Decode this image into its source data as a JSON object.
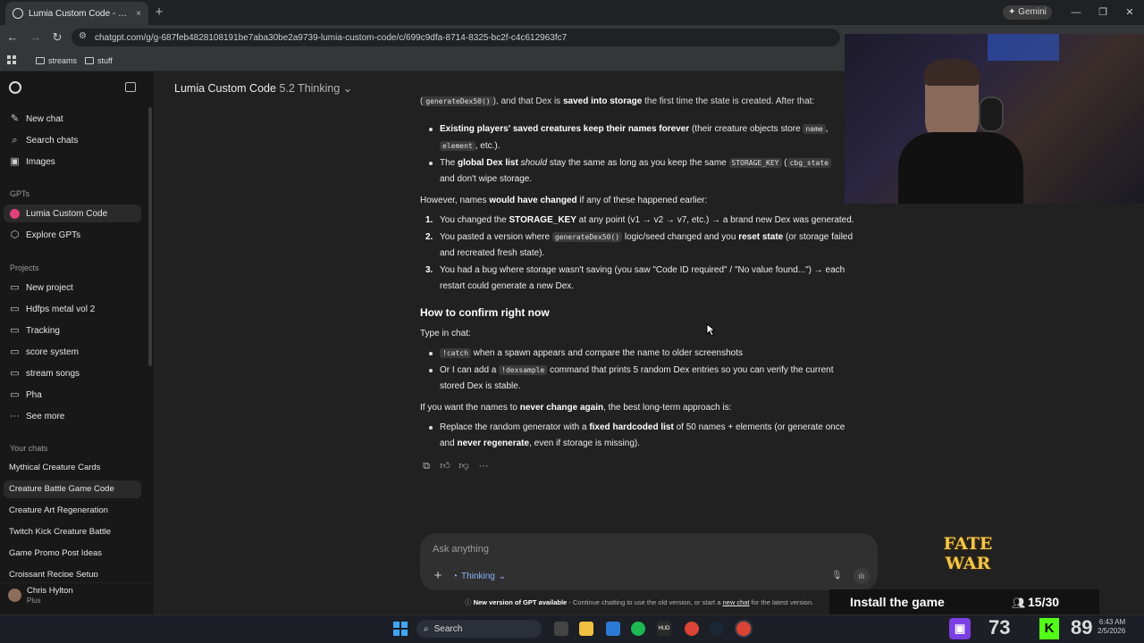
{
  "browser": {
    "tab_title": "Lumia Custom Code - Creature",
    "url": "chatgpt.com/g/g-687feb4828108191be7aba30be2a9739-lumia-custom-code/c/699c9dfa-8714-8325-bc2f-c4c612963fc7",
    "gemini_label": "Gemini",
    "bookmarks": [
      "streams",
      "stuff"
    ]
  },
  "sidebar": {
    "top_items": [
      {
        "label": "New chat",
        "icon": "edit-icon"
      },
      {
        "label": "Search chats",
        "icon": "search-icon"
      },
      {
        "label": "Images",
        "icon": "image-icon"
      }
    ],
    "gpts_heading": "GPTs",
    "gpts": [
      {
        "label": "Lumia Custom Code",
        "active": true
      },
      {
        "label": "Explore GPTs",
        "active": false
      }
    ],
    "projects_heading": "Projects",
    "projects": [
      "New project",
      "Hdfps metal vol 2",
      "Tracking",
      "score system",
      "stream songs",
      "Pha",
      "See more"
    ],
    "chats_heading": "Your chats",
    "chats": [
      "Mythical Creature Cards",
      "Creature Battle Game Code",
      "Creature Art Regeneration",
      "Twitch Kick Creature Battle",
      "Game Promo Post Ideas",
      "Croissant Recipe Setup"
    ],
    "active_chat_index": 1,
    "user": {
      "name": "Chris Hylton",
      "plan": "Plus"
    }
  },
  "header": {
    "title": "Lumia Custom Code",
    "model": "5.2 Thinking"
  },
  "message": {
    "line0_pre": "(",
    "line0_code": "generateDex50()",
    "line0_mid": "), and that Dex is ",
    "line0_bold": "saved into storage",
    "line0_post": " the first time the state is created. After that:",
    "b1_bold": "Existing players' saved creatures keep their names forever",
    "b1_text": " (their creature objects store ",
    "b1_code1": "name",
    "b1_code2": "element",
    "b1_text2": ", etc.).",
    "b2_pre": "The ",
    "b2_bold": "global Dex list",
    "b2_mid": " ",
    "b2_italic": "should",
    "b2_text": " stay the same as long as you keep the same ",
    "b2_code1": "STORAGE_KEY",
    "b2_paren": " (",
    "b2_code2": "cbg_state",
    "b2_line2": "and don't wipe storage.",
    "p2_pre": "However, names ",
    "p2_bold": "would have changed",
    "p2_post": " if any of these happened earlier:",
    "n1_pre": "You changed the ",
    "n1_bold": "STORAGE_KEY",
    "n1_post": " at any point (v1 → v2 → v7, etc.) → a brand new Dex was generated.",
    "n2_pre": "You pasted a version where ",
    "n2_code": "generateDex50()",
    "n2_mid": " logic/seed changed and you ",
    "n2_bold": "reset state",
    "n2_post": " (or storage failed",
    "n2_line2": "and recreated fresh state).",
    "n3_line1": "You had a bug where storage wasn't saving (you saw \"Code ID required\" / \"No value found...\") → each",
    "n3_line2": "restart could generate a new Dex.",
    "h3": "How to confirm right now",
    "p3": "Type in chat:",
    "c1_code": "!catch",
    "c1_text": " when a spawn appears and compare the name to older screenshots",
    "c2_pre": "Or I can add a ",
    "c2_code": "!dexsample",
    "c2_text": " command that prints 5 random Dex entries so you can verify the current",
    "c2_line2": "stored Dex is stable.",
    "p4_pre": "If you want the names to ",
    "p4_bold": "never change again",
    "p4_post": ", the best long-term approach is:",
    "d1_pre": "Replace the random generator with a ",
    "d1_bold": "fixed hardcoded list",
    "d1_post": " of 50 names + elements (or generate once",
    "d1_l2_pre": "and ",
    "d1_l2_bold": "never regenerate",
    "d1_l2_post": ", even if storage is missing).",
    "numbers": [
      "1.",
      "2.",
      "3."
    ]
  },
  "composer": {
    "placeholder": "Ask anything",
    "thinking_label": "Thinking"
  },
  "footnote": {
    "bold": "New version of GPT available",
    "text": " - Continue chatting to use the old version, or start a ",
    "link": "new chat",
    "end": " for the latest version."
  },
  "overlay": {
    "game_logo": "FATE WAR",
    "install": "Install the game",
    "players": "15/30",
    "twitch_count": "73",
    "kick_count": "89"
  },
  "taskbar": {
    "search_label": "Search",
    "clock_time": "6:43 AM",
    "clock_date": "2/5/2026"
  }
}
